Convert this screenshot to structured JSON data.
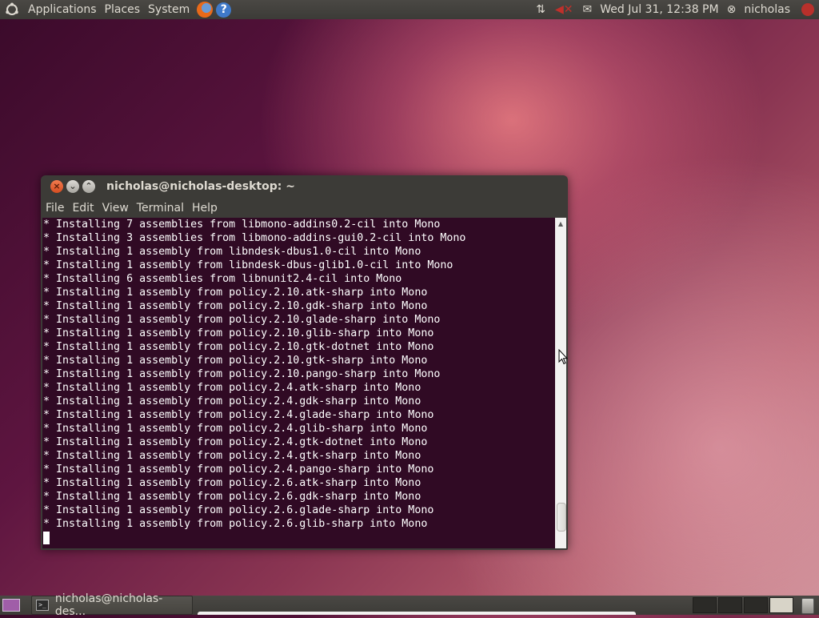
{
  "top_panel": {
    "menus": [
      "Applications",
      "Places",
      "System"
    ],
    "icons": [
      "ubuntu-logo-icon",
      "firefox-icon",
      "help-icon",
      "network-icon",
      "volume-icon",
      "mail-icon",
      "session-icon",
      "power-icon"
    ],
    "clock": "Wed Jul 31, 12:38 PM",
    "user": "nicholas"
  },
  "window": {
    "title": "nicholas@nicholas-desktop: ~",
    "menu": [
      "File",
      "Edit",
      "View",
      "Terminal",
      "Help"
    ]
  },
  "terminal": {
    "background": "#300a24",
    "lines": [
      "* Installing 7 assemblies from libmono-addins0.2-cil into Mono",
      "* Installing 3 assemblies from libmono-addins-gui0.2-cil into Mono",
      "* Installing 1 assembly from libndesk-dbus1.0-cil into Mono",
      "* Installing 1 assembly from libndesk-dbus-glib1.0-cil into Mono",
      "* Installing 6 assemblies from libnunit2.4-cil into Mono",
      "* Installing 1 assembly from policy.2.10.atk-sharp into Mono",
      "* Installing 1 assembly from policy.2.10.gdk-sharp into Mono",
      "* Installing 1 assembly from policy.2.10.glade-sharp into Mono",
      "* Installing 1 assembly from policy.2.10.glib-sharp into Mono",
      "* Installing 1 assembly from policy.2.10.gtk-dotnet into Mono",
      "* Installing 1 assembly from policy.2.10.gtk-sharp into Mono",
      "* Installing 1 assembly from policy.2.10.pango-sharp into Mono",
      "* Installing 1 assembly from policy.2.4.atk-sharp into Mono",
      "* Installing 1 assembly from policy.2.4.gdk-sharp into Mono",
      "* Installing 1 assembly from policy.2.4.glade-sharp into Mono",
      "* Installing 1 assembly from policy.2.4.glib-sharp into Mono",
      "* Installing 1 assembly from policy.2.4.gtk-dotnet into Mono",
      "* Installing 1 assembly from policy.2.4.gtk-sharp into Mono",
      "* Installing 1 assembly from policy.2.4.pango-sharp into Mono",
      "* Installing 1 assembly from policy.2.6.atk-sharp into Mono",
      "* Installing 1 assembly from policy.2.6.gdk-sharp into Mono",
      "* Installing 1 assembly from policy.2.6.glade-sharp into Mono",
      "* Installing 1 assembly from policy.2.6.glib-sharp into Mono"
    ]
  },
  "taskbar": {
    "task_label": "nicholas@nicholas-des...",
    "workspace_count": 4,
    "active_workspace": 4
  }
}
